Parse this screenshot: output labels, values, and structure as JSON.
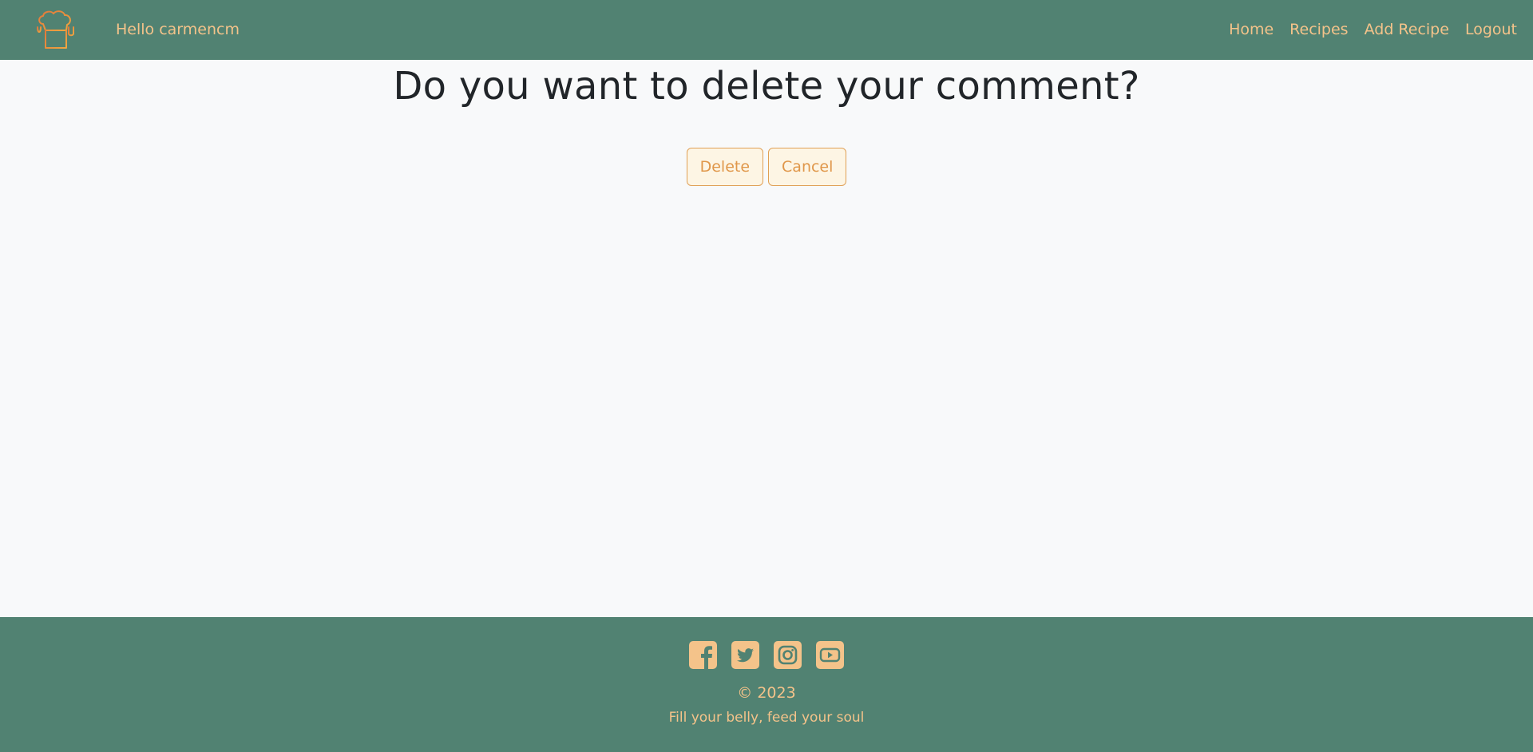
{
  "header": {
    "greeting": "Hello carmencm",
    "nav": [
      {
        "label": "Home"
      },
      {
        "label": "Recipes"
      },
      {
        "label": "Add Recipe"
      },
      {
        "label": "Logout"
      }
    ]
  },
  "main": {
    "title": "Do you want to delete your comment?",
    "delete_label": "Delete",
    "cancel_label": "Cancel"
  },
  "footer": {
    "social": [
      "facebook-icon",
      "twitter-icon",
      "instagram-icon",
      "youtube-icon"
    ],
    "copyright": "© 2023",
    "tagline": "Fill your belly, feed your soul"
  },
  "colors": {
    "nav_bg": "#518272",
    "accent": "#f4c38a",
    "button_text": "#e0974a",
    "button_border": "#e0a055",
    "page_bg": "#f8f9fa"
  }
}
